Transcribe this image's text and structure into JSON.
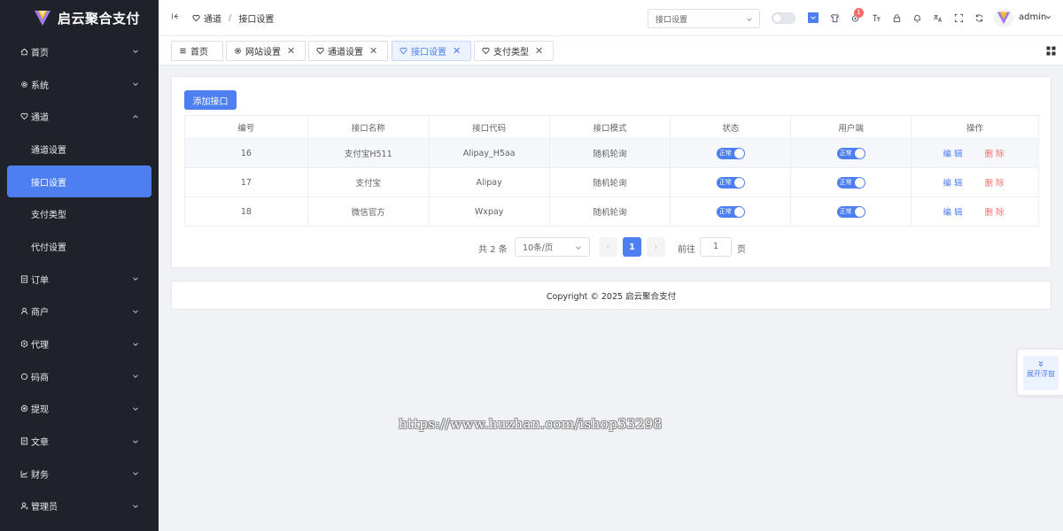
{
  "app": {
    "title": "启云聚合支付"
  },
  "sidebar": {
    "items": [
      {
        "label": "首页",
        "icon": "home-icon"
      },
      {
        "label": "系统",
        "icon": "gear-icon"
      },
      {
        "label": "通道",
        "icon": "heart-icon",
        "expanded": true,
        "children": [
          {
            "label": "通道设置"
          },
          {
            "label": "接口设置",
            "active": true
          },
          {
            "label": "支付类型"
          },
          {
            "label": "代付设置"
          }
        ]
      },
      {
        "label": "订单",
        "icon": "order-icon"
      },
      {
        "label": "商户",
        "icon": "user-icon"
      },
      {
        "label": "代理",
        "icon": "agent-icon"
      },
      {
        "label": "码商",
        "icon": "circle-icon"
      },
      {
        "label": "提现",
        "icon": "withdraw-icon"
      },
      {
        "label": "文章",
        "icon": "article-icon"
      },
      {
        "label": "财务",
        "icon": "chart-icon"
      },
      {
        "label": "管理员",
        "icon": "admin-icon"
      }
    ]
  },
  "header": {
    "breadcrumb": [
      "通道",
      "接口设置"
    ],
    "select_value": "接口设置",
    "notification_count": "1",
    "user": "admin"
  },
  "tabs": [
    {
      "label": "首页",
      "icon": "menu-icon",
      "closable": false
    },
    {
      "label": "网站设置",
      "icon": "gear-icon",
      "closable": true
    },
    {
      "label": "通道设置",
      "icon": "heart-icon",
      "closable": true
    },
    {
      "label": "接口设置",
      "icon": "heart-icon",
      "closable": true,
      "active": true
    },
    {
      "label": "支付类型",
      "icon": "heart-icon",
      "closable": true
    }
  ],
  "toolbar": {
    "add_label": "添加接口"
  },
  "table": {
    "columns": [
      "编号",
      "接口名称",
      "接口代码",
      "接口模式",
      "状态",
      "用户端",
      "操作"
    ],
    "rows": [
      {
        "id": "16",
        "name": "支付宝H511",
        "code": "Alipay_H5aa",
        "mode": "随机轮询",
        "status": "正常",
        "client": "正常"
      },
      {
        "id": "17",
        "name": "支付宝",
        "code": "Alipay",
        "mode": "随机轮询",
        "status": "正常",
        "client": "正常"
      },
      {
        "id": "18",
        "name": "微信官方",
        "code": "Wxpay",
        "mode": "随机轮询",
        "status": "正常",
        "client": "正常"
      }
    ],
    "edit_label": "编辑",
    "delete_label": "删除"
  },
  "pagination": {
    "total_text": "共 2 条",
    "page_size": "10条/页",
    "current_page": "1",
    "prev": "‹",
    "next": "›",
    "goto_label": "前往",
    "goto_value": "1",
    "page_suffix": "页"
  },
  "footer": {
    "text": "Copyright © 2025 启云聚合支付"
  },
  "float_panel": {
    "label": "展开浮窗"
  },
  "watermark": "https://www.huzhan.com/ishop33298",
  "colors": {
    "primary": "#4d7ff0",
    "danger": "#f56c6c",
    "sidebar_bg": "#1f2329"
  }
}
